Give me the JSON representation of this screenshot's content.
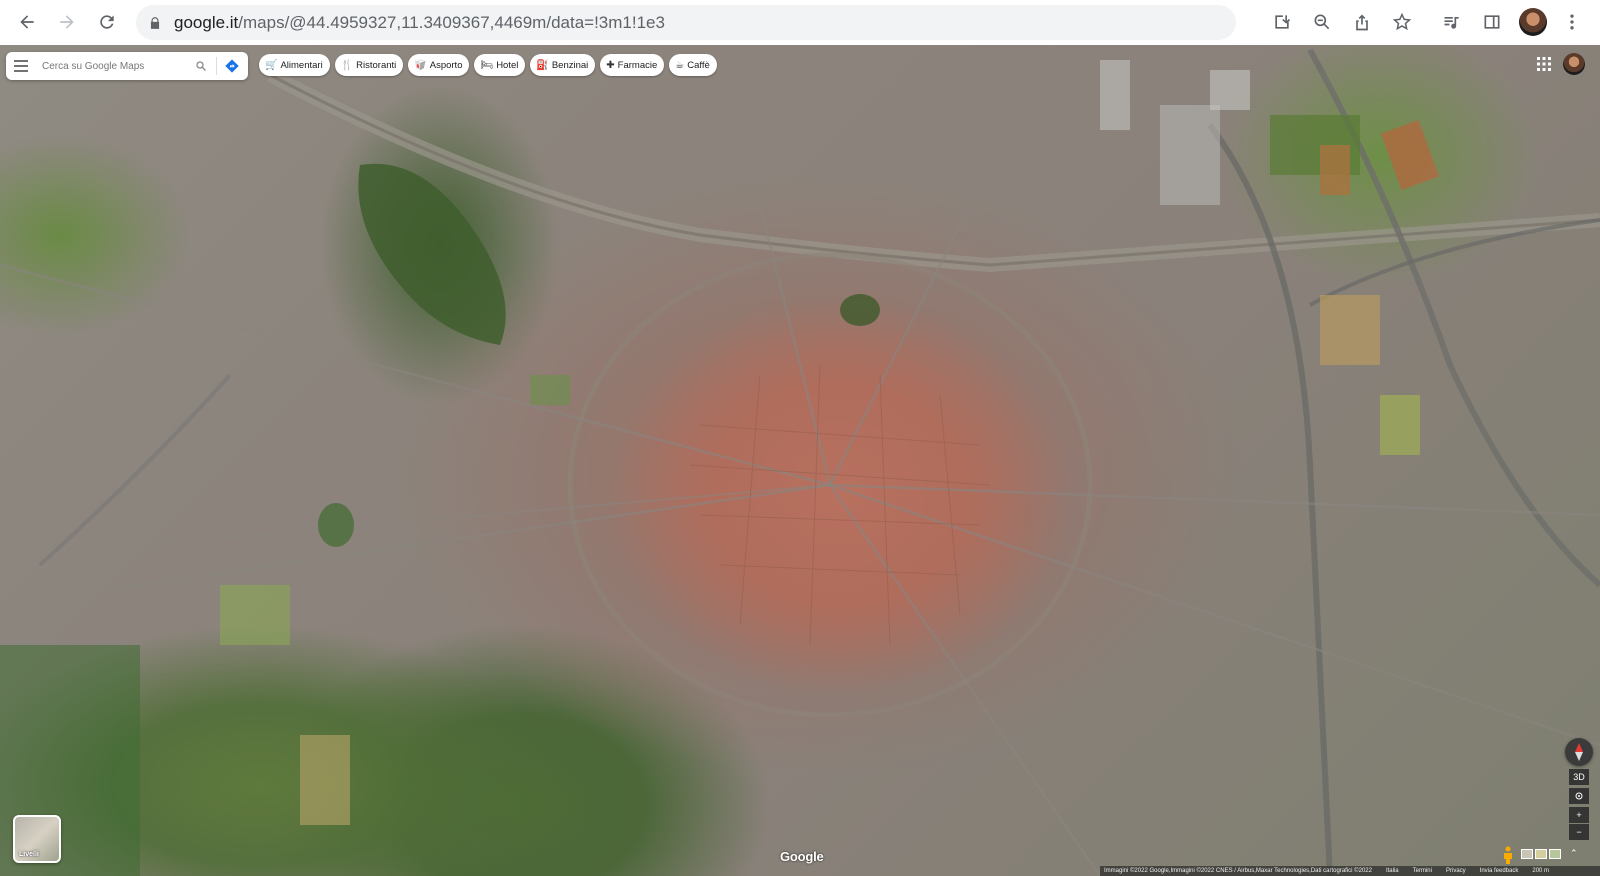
{
  "browser": {
    "url_host": "google.it",
    "url_path": "/maps/@44.4959327,11.3409367,4469m/data=!3m1!1e3"
  },
  "search": {
    "placeholder": "Cerca su Google Maps"
  },
  "chips": [
    {
      "label": "Alimentari",
      "glyph": "🛒"
    },
    {
      "label": "Ristoranti",
      "glyph": "🍴"
    },
    {
      "label": "Asporto",
      "glyph": "🥡"
    },
    {
      "label": "Hotel",
      "glyph": "🛏"
    },
    {
      "label": "Benzinai",
      "glyph": "⛽"
    },
    {
      "label": "Farmacie",
      "glyph": "✚"
    },
    {
      "label": "Caffè",
      "glyph": "☕"
    }
  ],
  "layers": {
    "label": "Livelli"
  },
  "controls": {
    "three_d": "3D",
    "zoom_in": "+",
    "zoom_out": "−"
  },
  "map": {
    "brand": "Google"
  },
  "footer": {
    "attribution": "Immagini ©2022 Google,Immagini ©2022 CNES / Airbus,Maxar Technologies,Dati cartografici ©2022",
    "country": "Italia",
    "terms": "Termini",
    "privacy": "Privacy",
    "feedback": "Invia feedback",
    "scale": "200 m"
  }
}
